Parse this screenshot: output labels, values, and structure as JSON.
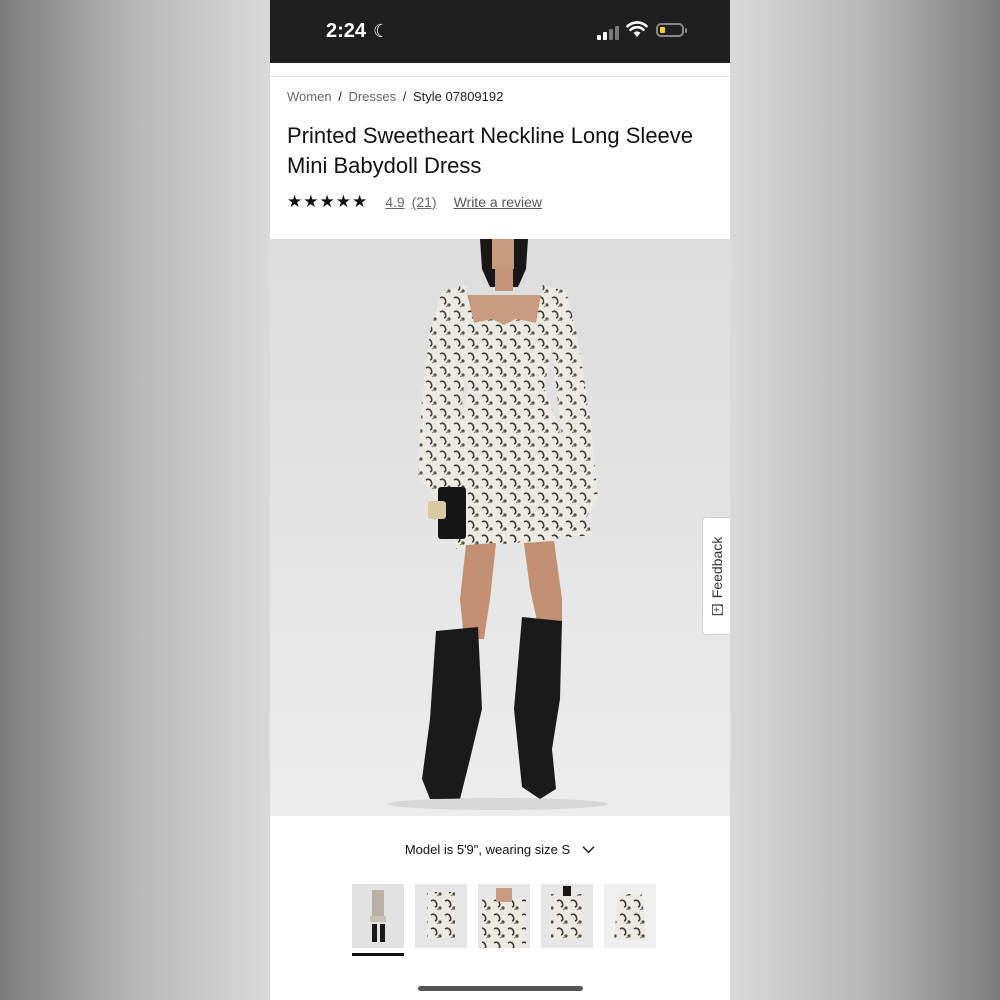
{
  "status_bar": {
    "time": "2:24",
    "moon_icon": "☾",
    "icons": [
      "signal-icon",
      "wifi-icon",
      "battery-icon"
    ]
  },
  "breadcrumb": {
    "items": [
      "Women",
      "Dresses"
    ],
    "separator": "/",
    "current": "Style 07809192"
  },
  "product": {
    "title": "Printed Sweetheart Neckline Long Sleeve Mini Babydoll Dress",
    "stars": "★★★★★",
    "rating": "4.9",
    "review_count": "(21)",
    "write_review": "Write a review",
    "model_info": "Model is 5'9\", wearing size S"
  },
  "feedback": {
    "label": "Feedback",
    "icon": "[+]"
  },
  "gallery": {
    "thumbnail_count": 5,
    "active_index": 0
  },
  "colors": {
    "status_bar_bg": "#1f1f1f",
    "text": "#111111",
    "muted": "#666666",
    "battery_fill": "#f2d43a"
  }
}
